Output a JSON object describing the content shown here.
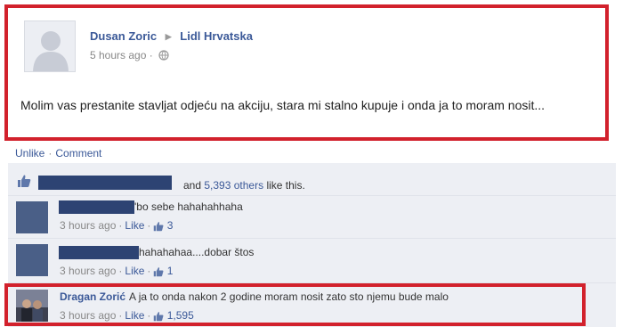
{
  "post": {
    "author": "Dusan Zoric",
    "target_page": "Lidl Hrvatska",
    "time": "5 hours ago",
    "time_sep": "·",
    "text": "Molim vas prestanite stavljat odjeću na akciju, stara mi stalno kupuje i onda ja to moram nosit..."
  },
  "actions": {
    "unlike": "Unlike",
    "sep": "·",
    "comment": "Comment"
  },
  "likes": {
    "and_text": "and",
    "others_link": "5,393 others",
    "like_this": "like this."
  },
  "comments": [
    {
      "name": "",
      "text": "'bo sebe hahahahhaha",
      "time": "3 hours ago",
      "like_label": "Like",
      "likes": "3"
    },
    {
      "name": "",
      "text": "hahahahaa....dobar štos",
      "time": "3 hours ago",
      "like_label": "Like",
      "likes": "1"
    },
    {
      "name": "Dragan Zorić",
      "text": "A ja to onda nakon 2 godine moram nosit zato sto njemu bude malo",
      "time": "3 hours ago",
      "like_label": "Like",
      "likes": "1,595"
    }
  ],
  "colors": {
    "highlight": "#d2212c",
    "link": "#3b5998",
    "panel": "#edeff4",
    "redaction": "#2d4373"
  },
  "icons": [
    "default-avatar-icon",
    "arrow-right-icon",
    "globe-icon",
    "thumbs-up-icon"
  ]
}
